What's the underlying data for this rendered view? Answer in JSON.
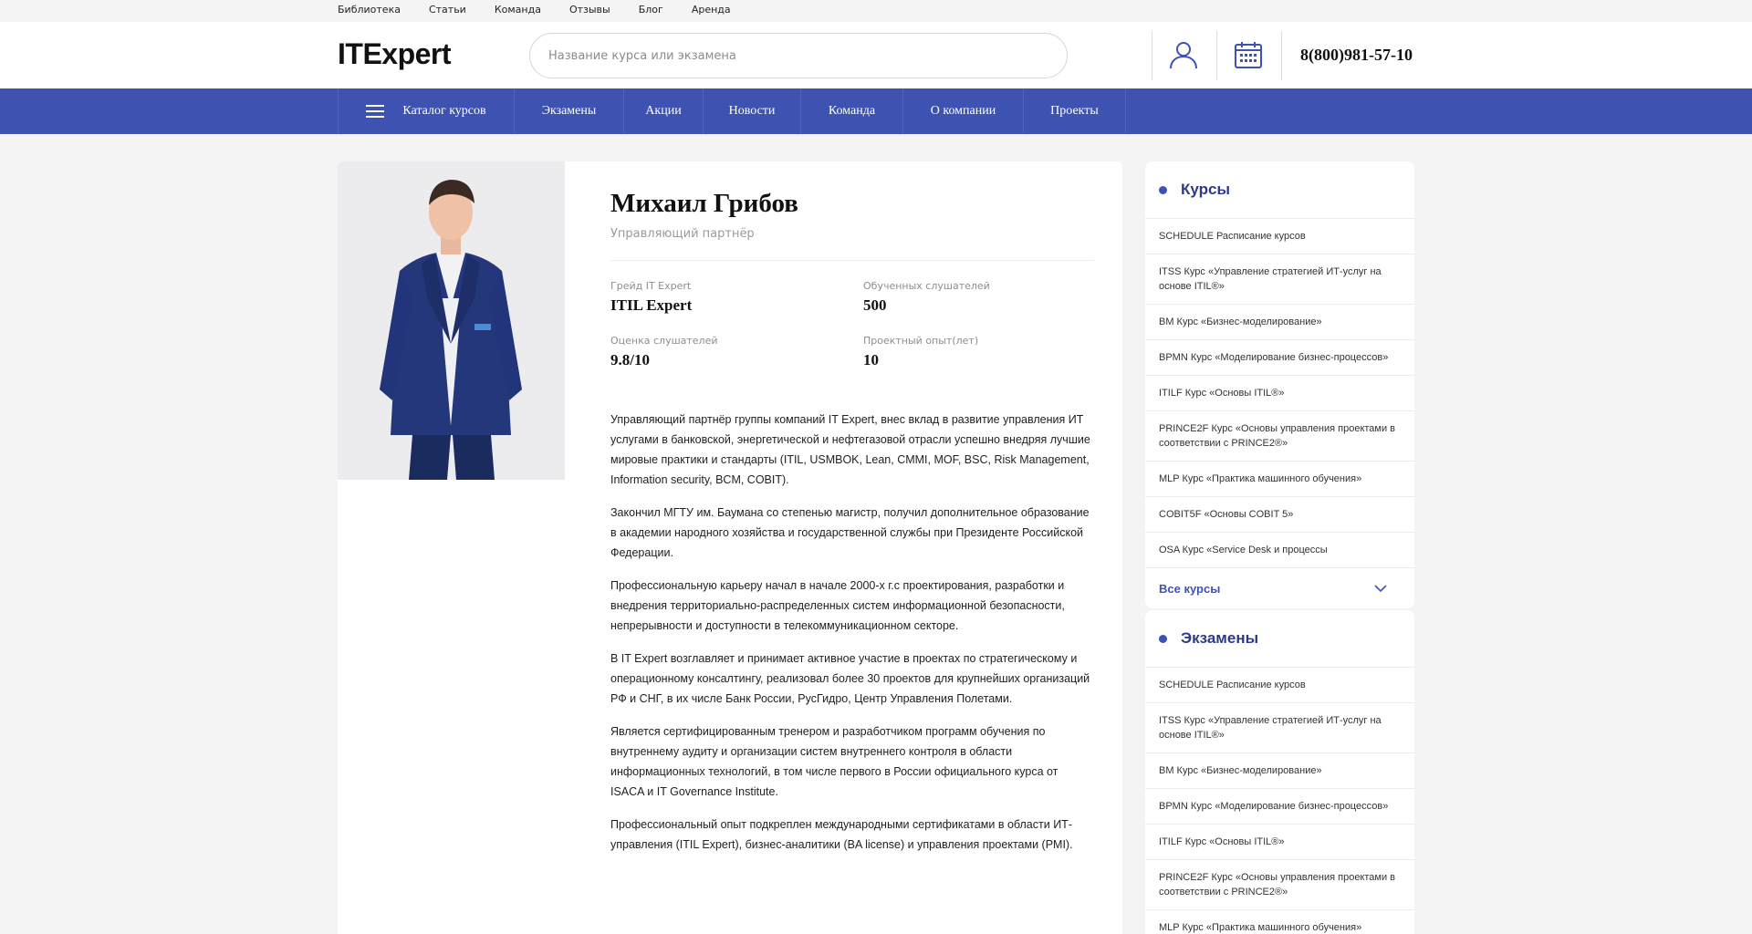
{
  "top_links": [
    "Библиотека",
    "Статьи",
    "Команда",
    "Отзывы",
    "Блог",
    "Аренда"
  ],
  "header": {
    "logo": "ITExpert",
    "search_placeholder": "Название курса или экзамена",
    "phone": "8(800)981-57-10",
    "user_icon": "user-icon",
    "calendar_icon": "calendar-icon"
  },
  "nav": {
    "catalog": "Каталог курсов",
    "items": [
      "Экзамены",
      "Акции",
      "Новости",
      "Команда",
      "О компании",
      "Проекты"
    ]
  },
  "profile": {
    "name": "Михаил Грибов",
    "role": "Управляющий партнёр",
    "stats": [
      {
        "label": "Грейд IT Expert",
        "value": "ITIL Expert"
      },
      {
        "label": "Обученных слушателей",
        "value": "500"
      },
      {
        "label": "Оценка слушателей",
        "value": "9.8/10"
      },
      {
        "label": "Проектный опыт(лет)",
        "value": "10"
      }
    ],
    "bio": [
      "Управляющий партнёр группы компаний IT Expert, внес вклад в развитие управления ИТ услугами в банковской, энергетической и нефтегазовой отрасли успешно внедряя лучшие мировые практики и стандарты (ITIL, USMBOK, Lean, CMMI, MOF, BSC, Risk Management, Information security, BCM, COBIT).",
      "Закончил МГТУ им. Баумана со степенью магистр, получил дополнительное образование в академии народного хозяйства и государственной службы при Президенте Российской Федерации.",
      "Профессиональную карьеру начал в начале 2000-х г.с проектирования, разработки и внедрения территориально-распределенных систем информационной безопасности, непрерывности и доступности в телекоммуникационном секторе.",
      "В IT Expert возглавляет и принимает активное участие в проектах по стратегическому и операционному консалтингу, реализовал более 30 проектов для крупнейших организаций РФ и СНГ, в их числе Банк России, РусГидро, Центр Управления Полетами.",
      "Является сертифицированным тренером и разработчиком программ обучения по внутреннему аудиту и организации систем внутреннего контроля в области информационных технологий, в том числе первого в России официального курса от ISACA и IT Governance Institute.",
      "Профессиональный опыт подкреплен международными сертификатами в области ИТ-управления (ITIL Expert), бизнес-аналитики (BA license) и управления проектами (PMI)."
    ]
  },
  "courses": {
    "title": "Курсы",
    "items": [
      "SCHEDULE Расписание курсов",
      "ITSS Курс «Управление стратегией ИТ-услуг на основе ITIL®»",
      "BM Курс «Бизнес-моделирование»",
      "BPMN Курс «Моделирование бизнес-процессов»",
      "ITILF Курс «Основы ITIL®»",
      "PRINCE2F Курс «Основы управления проектами в соответствии с PRINCE2®»",
      "MLP Курс «Практика машинного обучения»",
      "COBIT5F «Основы COBIT 5»",
      "OSA Курс «Service Desk и процессы"
    ],
    "all_label": "Все курсы"
  },
  "exams": {
    "title": "Экзамены",
    "items": [
      "SCHEDULE Расписание курсов",
      "ITSS Курс «Управление стратегией ИТ-услуг на основе ITIL®»",
      "BM Курс «Бизнес-моделирование»",
      "BPMN Курс «Моделирование бизнес-процессов»",
      "ITILF Курс «Основы ITIL®»",
      "PRINCE2F Курс «Основы управления проектами в соответствии с PRINCE2®»",
      "MLP Курс «Практика машинного обучения»"
    ]
  }
}
